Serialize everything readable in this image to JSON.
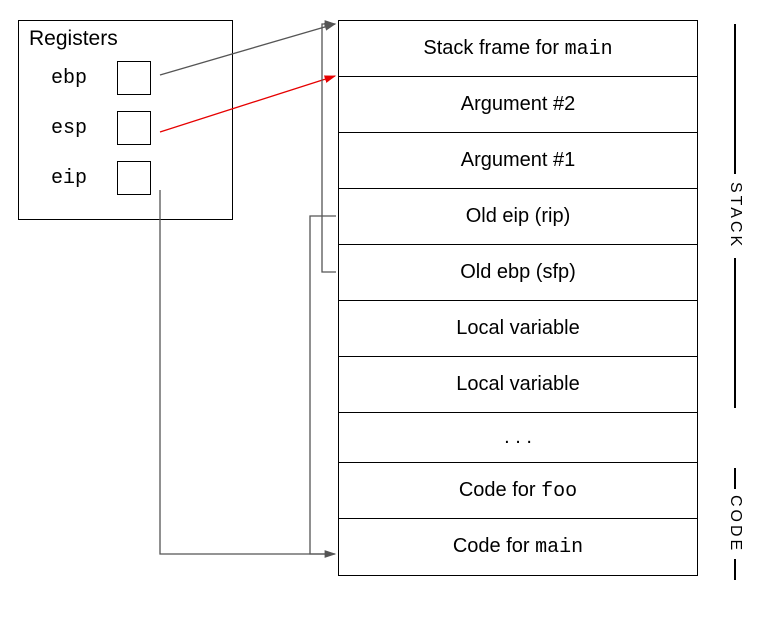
{
  "registers": {
    "title": "Registers",
    "items": [
      {
        "name": "ebp"
      },
      {
        "name": "esp"
      },
      {
        "name": "eip"
      }
    ]
  },
  "stack": {
    "rows": [
      "Stack frame for main",
      "Argument #2",
      "Argument #1",
      "Old eip (rip)",
      "Old ebp (sfp)",
      "Local variable",
      "Local variable",
      ". . .",
      "Code for foo",
      "Code for main"
    ]
  },
  "sideLabels": {
    "stack": "STACK",
    "code": "CODE"
  },
  "arrows": {
    "ebp_to_main_frame": {
      "color": "#555555"
    },
    "esp_to_arg2": {
      "color": "#e60000"
    },
    "eip_to_code_main": {
      "color": "#555555"
    },
    "old_eip_bracket": {
      "color": "#555555"
    },
    "old_ebp_bracket": {
      "color": "#555555"
    }
  }
}
